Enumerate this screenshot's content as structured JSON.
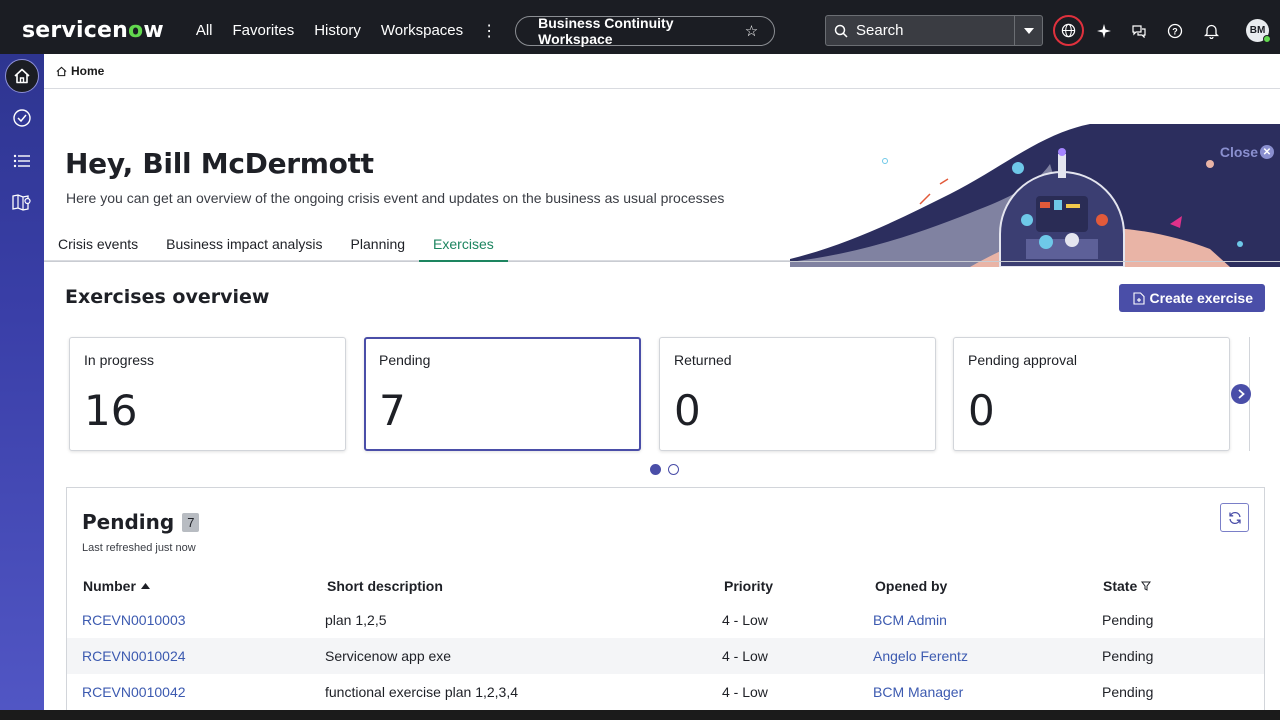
{
  "topbar": {
    "logo_pre": "servicen",
    "logo_o": "o",
    "logo_post": "w",
    "nav": [
      "All",
      "Favorites",
      "History",
      "Workspaces"
    ],
    "more": "⋮",
    "workspace": "Business Continuity Workspace",
    "star": "☆",
    "search_label": "Search",
    "avatar_initials": "BM"
  },
  "breadcrumb": {
    "home": "Home"
  },
  "hero": {
    "title": "Hey, Bill McDermott",
    "subtitle": "Here you can get an overview of the ongoing crisis event and updates on the business as usual processes",
    "close": "Close"
  },
  "tabs": [
    {
      "label": "Crisis events",
      "active": false
    },
    {
      "label": "Business impact analysis",
      "active": false
    },
    {
      "label": "Planning",
      "active": false
    },
    {
      "label": "Exercises",
      "active": true
    }
  ],
  "overview": {
    "title": "Exercises overview",
    "create_label": "Create exercise",
    "cards": [
      {
        "label": "In progress",
        "value": "16",
        "selected": false
      },
      {
        "label": "Pending",
        "value": "7",
        "selected": true
      },
      {
        "label": "Returned",
        "value": "0",
        "selected": false
      },
      {
        "label": "Pending approval",
        "value": "0",
        "selected": false
      }
    ],
    "page_count": 2,
    "current_page": 1
  },
  "list": {
    "title": "Pending",
    "count": "7",
    "refreshed": "Last refreshed just now",
    "columns": [
      "Number",
      "Short description",
      "Priority",
      "Opened by",
      "State"
    ],
    "rows": [
      {
        "number": "RCEVN0010003",
        "desc": "plan 1,2,5",
        "priority": "4 - Low",
        "opened_by": "BCM Admin",
        "state": "Pending"
      },
      {
        "number": "RCEVN0010024",
        "desc": "Servicenow app exe",
        "priority": "4 - Low",
        "opened_by": "Angelo Ferentz",
        "state": "Pending"
      },
      {
        "number": "RCEVN0010042",
        "desc": "functional exercise plan 1,2,3,4",
        "priority": "4 - Low",
        "opened_by": "BCM Manager",
        "state": "Pending"
      }
    ]
  },
  "colors": {
    "accent": "#4a4ea8",
    "active_tab": "#1d8560",
    "link": "#3c5ab0",
    "topbar": "#1b1d23"
  }
}
